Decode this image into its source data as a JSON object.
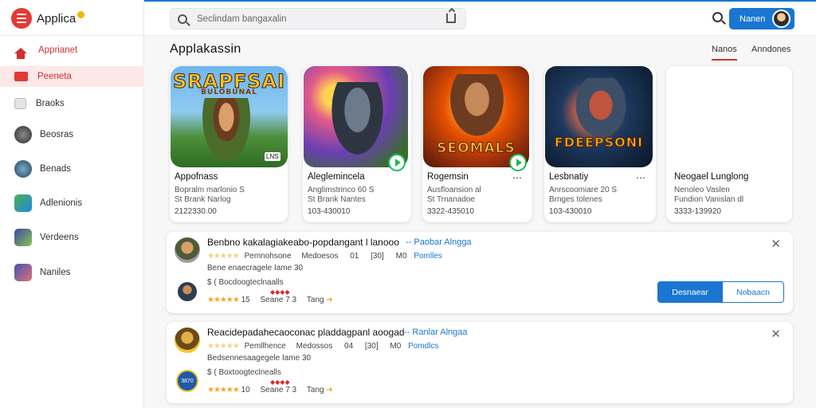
{
  "app": {
    "name": "Applica"
  },
  "colors": {
    "accent": "#d32f2f",
    "primary": "#1976d2",
    "star": "#f5a623"
  },
  "search": {
    "placeholder": "Seclindam bangaxalin"
  },
  "topbar": {
    "signin_label": "Nanen"
  },
  "sidebar": {
    "items": [
      {
        "label": "Apprianet",
        "icon": "home-icon"
      },
      {
        "label": "Peeneta",
        "icon": "mail-icon"
      },
      {
        "label": "Braoks",
        "icon": "book-icon"
      },
      {
        "label": "Beosras"
      },
      {
        "label": "Benads"
      },
      {
        "label": "Adlenionis"
      },
      {
        "label": "Verdeens"
      },
      {
        "label": "Naniles"
      }
    ]
  },
  "section": {
    "title": "Applakassin",
    "tabs": [
      "Nanos",
      "Anndones"
    ]
  },
  "apps": [
    {
      "name": "Appofnass",
      "meta1": "Bopralm marlonio S",
      "meta2": "St Brank Narlog",
      "size": "2122330.00",
      "art_title": "SRAPFSAI",
      "art_sub": "BULOBUNAL",
      "art_tag": "LNS"
    },
    {
      "name": "Aleglemincela",
      "meta1": "Anglimstrinco 60 S",
      "meta2": "St Brank Nantes",
      "size": "103-430010",
      "art_title": "",
      "art_sub": "",
      "art_tag": ""
    },
    {
      "name": "Rogemsin",
      "meta1": "Ausfloansion al",
      "meta2": "St Trnanadoe",
      "size": "3322-435010",
      "art_title": "SEOMALS",
      "art_sub": "",
      "art_tag": ""
    },
    {
      "name": "Lesbnatiy",
      "meta1": "Anrscoomiare 20 S",
      "meta2": "Brnges tolenes",
      "size": "103-430010",
      "art_title": "FDEEPSONI",
      "art_sub": "",
      "art_tag": ""
    },
    {
      "name": "Neogael Lunglong",
      "meta1": "Nenoleo Vaslen",
      "meta2": "Fundion Vanislan dl",
      "size": "3333-139920",
      "art_title": "",
      "art_sub": "",
      "art_tag": ""
    }
  ],
  "reviews": [
    {
      "title": "Benbno kakalagiakeabo-popdangant l lanooo",
      "link": "-- Paobar Alngga",
      "line1_a": "Pemnohsone",
      "line1_b": "Medoesos",
      "line1_c": "01",
      "line1_d": "[30]",
      "line1_e": "M0",
      "line1_link": "Pomlles",
      "line2": "Bene enaecragele Iame 30",
      "line3": "$ ( Bocdoogteclnaalls",
      "line4_rating": "15",
      "line4_b": "Seane 7 3",
      "line4_c": "Tang",
      "btn_primary": "Desnaear",
      "btn_secondary": "Nobaacn"
    },
    {
      "title": "Reacidepadahecaoconac pladdagpanl aoogad",
      "link": "-- Ranlar Alngaa",
      "line1_a": "Pemllhence",
      "line1_b": "Medossos",
      "line1_c": "04",
      "line1_d": "[30]",
      "line1_e": "M0",
      "line1_link": "Pomdlcs",
      "line2": "Bedsennesaagegele Iame 30",
      "line3": "$ ( Boxtoogteclnealls",
      "line4_rating": "10",
      "line4_b": "Seane 7 3",
      "line4_c": "Tang",
      "badge": "3870"
    }
  ]
}
